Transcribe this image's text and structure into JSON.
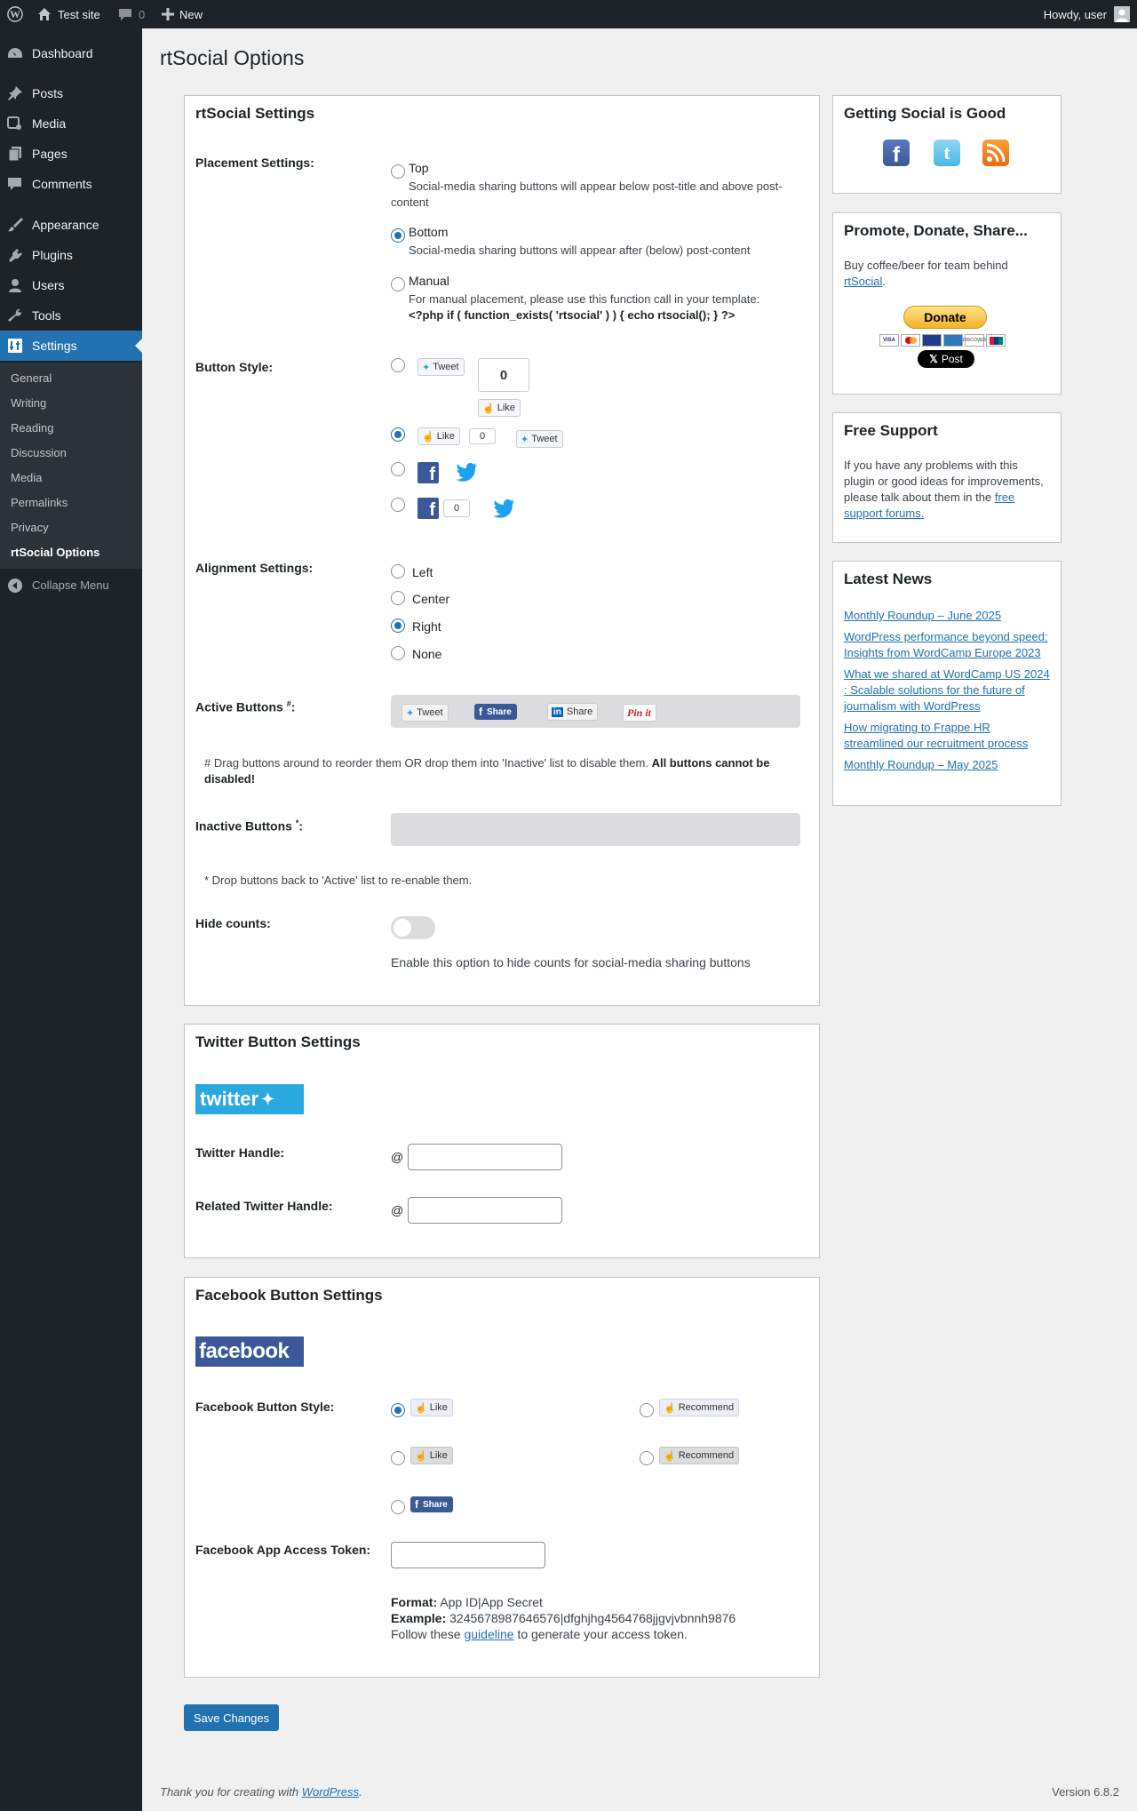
{
  "adminbar": {
    "site_name": "Test site",
    "comments_count": "0",
    "new_label": "New",
    "howdy": "Howdy, user"
  },
  "sidebar": {
    "menu": [
      {
        "label": "Dashboard",
        "icon": "dashboard-icon"
      },
      {
        "label": "Posts",
        "icon": "pin-icon"
      },
      {
        "label": "Media",
        "icon": "media-icon"
      },
      {
        "label": "Pages",
        "icon": "pages-icon"
      },
      {
        "label": "Comments",
        "icon": "comments-icon"
      },
      {
        "label": "Appearance",
        "icon": "brush-icon"
      },
      {
        "label": "Plugins",
        "icon": "plug-icon"
      },
      {
        "label": "Users",
        "icon": "users-icon"
      },
      {
        "label": "Tools",
        "icon": "wrench-icon"
      },
      {
        "label": "Settings",
        "icon": "settings-icon"
      }
    ],
    "submenu": [
      "General",
      "Writing",
      "Reading",
      "Discussion",
      "Media",
      "Permalinks",
      "Privacy",
      "rtSocial Options"
    ],
    "collapse_label": "Collapse Menu"
  },
  "page": {
    "title": "rtSocial Options"
  },
  "settings": {
    "heading": "rtSocial Settings",
    "placement": {
      "label": "Placement Settings:",
      "options": [
        {
          "name": "Top",
          "desc": "Social-media sharing buttons will appear below post-title and above post-",
          "desc2": "content"
        },
        {
          "name": "Bottom",
          "desc": "Social-media sharing buttons will appear after (below) post-content",
          "desc2": ""
        },
        {
          "name": "Manual",
          "desc": "For manual placement, please use this function call in your template:",
          "desc2": "<?php if ( function_exists( 'rtsocial' ) ) { echo rtsocial(); } ?>"
        }
      ],
      "selected": "Bottom"
    },
    "button_style": {
      "label": "Button Style:",
      "tweet": "Tweet",
      "like": "Like",
      "count": "0"
    },
    "alignment": {
      "label": "Alignment Settings:",
      "options": [
        "Left",
        "Center",
        "Right",
        "None"
      ],
      "selected": "Right"
    },
    "active": {
      "label": "Active Buttons",
      "sup": "#",
      "buttons": [
        "Tweet",
        "Share",
        "Share",
        "Pin it"
      ],
      "note": "# Drag buttons around to reorder them OR drop them into 'Inactive' list to disable them.",
      "note_bold": "All buttons cannot be",
      "note_bold2": "disabled!"
    },
    "inactive": {
      "label": "Inactive Buttons",
      "sup": "*",
      "note": "* Drop buttons back to 'Active' list to re-enable them."
    },
    "hide_counts": {
      "label": "Hide counts:",
      "desc": "Enable this option to hide counts for social-media sharing buttons",
      "enabled": false
    }
  },
  "twitter": {
    "heading": "Twitter Button Settings",
    "logo_text": "twitter",
    "handle_label": "Twitter Handle:",
    "related_label": "Related Twitter Handle:",
    "at": "@",
    "handle_value": "",
    "related_value": ""
  },
  "facebook": {
    "heading": "Facebook Button Settings",
    "logo_text": "facebook",
    "style_label": "Facebook Button Style:",
    "like": "Like",
    "recommend": "Recommend",
    "share": "Share",
    "token_label": "Facebook App Access Token:",
    "token_value": "",
    "format_key": "Format:",
    "format_val": "App ID|App Secret",
    "example_key": "Example:",
    "example_val": "3245678987646576|dfghjhg4564768jjgvjvbnnh9876",
    "follow_pre": "Follow these",
    "follow_link": "guideline",
    "follow_post": "to generate your access token."
  },
  "save_label": "Save Changes",
  "widgets": {
    "social": {
      "title": "Getting Social is Good"
    },
    "promote": {
      "title": "Promote, Donate, Share...",
      "text": "Buy coffee/beer for team behind",
      "link": "rtSocial",
      "donate": "Donate",
      "post": "Post"
    },
    "support": {
      "title": "Free Support",
      "text1": "If you have any problems with this",
      "text2": "plugin or good ideas for improvements,",
      "text3": "please talk about them in the",
      "link1": "free",
      "link2": "support forums."
    },
    "news": {
      "title": "Latest News",
      "items": [
        [
          "Monthly Roundup – June 2025"
        ],
        [
          "WordPress performance beyond speed:",
          "Insights from WordCamp Europe 2023"
        ],
        [
          "What we shared at WordCamp US 2024",
          ": Scalable solutions for the future of",
          "journalism with WordPress"
        ],
        [
          "How migrating to Frappe HR",
          "streamlined our recruitment process"
        ],
        [
          "Monthly Roundup – May 2025"
        ]
      ]
    }
  },
  "footer": {
    "thanks": "Thank you for creating with",
    "link": "WordPress",
    "version": "Version 6.8.2"
  },
  "colors": {
    "accent": "#2271b1",
    "facebook": "#3b5998",
    "twitter": "#1da1f2",
    "admin_dark": "#1d2327"
  }
}
